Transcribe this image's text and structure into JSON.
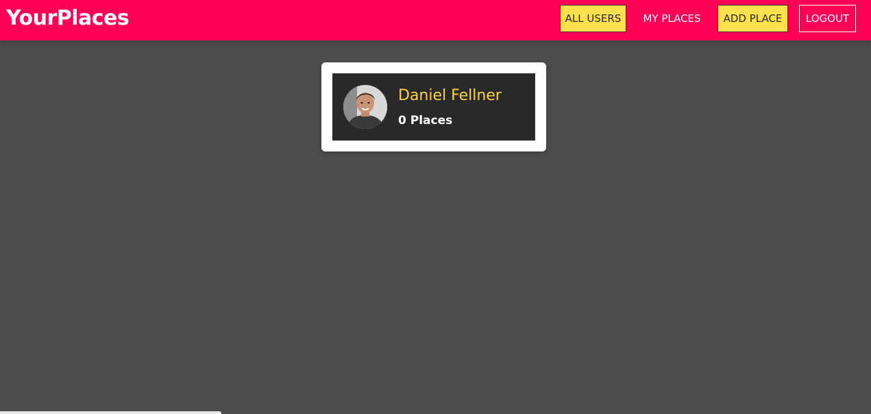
{
  "app": {
    "logo": "YourPlaces"
  },
  "nav": {
    "all_users": "ALL USERS",
    "my_places": "MY PLACES",
    "add_place": "ADD PLACE",
    "logout": "LOGOUT"
  },
  "users": [
    {
      "name": "Daniel Fellner",
      "places": "0 Places",
      "avatar_icon": "user-avatar-photo"
    }
  ],
  "colors": {
    "header": "#ff0055",
    "background": "#4d4d4d",
    "accent_yellow": "#ffe14d",
    "name_color": "#ffd43b",
    "card_inner": "#292929"
  }
}
